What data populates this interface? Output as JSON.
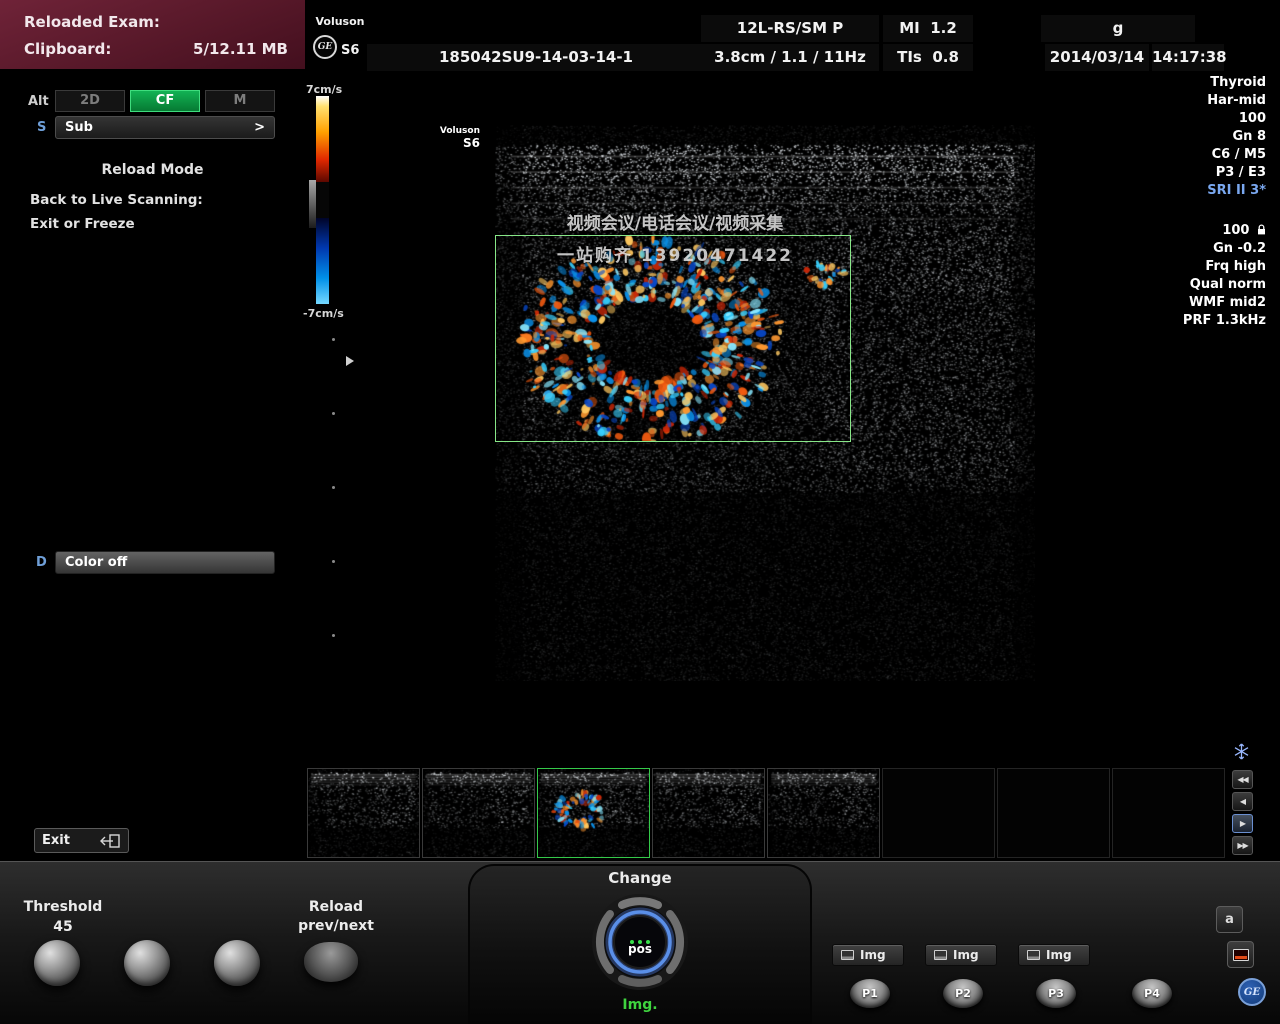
{
  "header": {
    "line1": "Reloaded Exam:",
    "line2_label": "Clipboard:",
    "line2_value": "5/12.11 MB"
  },
  "topbar": {
    "brand": "Voluson",
    "model": "S6",
    "ge_monogram": "GE",
    "exam_id": "185042SU9-14-03-14-1",
    "probe": "12L-RS/SM P",
    "scan_settings": "3.8cm / 1.1 / 11Hz",
    "mi_label": "MI",
    "mi_value": "1.2",
    "tis_label": "TIs",
    "tis_value": "0.8",
    "hospital_id": "g",
    "date": "2014/03/14",
    "time": "14:17:38"
  },
  "sidebar": {
    "alt_label": "Alt",
    "modes": [
      {
        "label": "2D",
        "active": false
      },
      {
        "label": "CF",
        "active": true
      },
      {
        "label": "M",
        "active": false
      }
    ],
    "s_label": "S",
    "sub_label": "Sub",
    "sub_arrow": ">",
    "section_title": "Reload Mode",
    "hint_line1": "Back to Live Scanning:",
    "hint_line2": "Exit or Freeze",
    "d_label": "D",
    "color_button": "Color off",
    "exit_button": "Exit"
  },
  "colorbar": {
    "top": "7cm/s",
    "bottom": "-7cm/s"
  },
  "image": {
    "probe_brand": "Voluson",
    "probe_model": "S6",
    "watermark_line1": "视频会议/电话会议/视频采集",
    "watermark_line2": "一站购齐 13920471422"
  },
  "params_right": {
    "b_mode": [
      "Thyroid",
      "Har-mid",
      "100",
      "Gn 8",
      "C6 / M5",
      "P3 / E3"
    ],
    "sri": "SRI II 3*",
    "cf_gain": "100",
    "cf_mode": [
      "Gn -0.2",
      "Frq high",
      "Qual norm",
      "WMF mid2",
      "PRF 1.3kHz"
    ]
  },
  "film_nav": {
    "first": "◀◀",
    "prev": "◀",
    "next": "▶",
    "last": "▶▶"
  },
  "bottom_panel": {
    "threshold_label": "Threshold",
    "threshold_value": "45",
    "reload_label": "Reload",
    "reload_sub": "prev/next",
    "change_label": "Change",
    "trackball_label": "pos",
    "trackball_status": "Img.",
    "img_buttons": [
      "Img",
      "Img",
      "Img"
    ],
    "p_buttons": [
      "P1",
      "P2",
      "P3",
      "P4"
    ],
    "a_key": "a",
    "ge_logo": "GE"
  }
}
